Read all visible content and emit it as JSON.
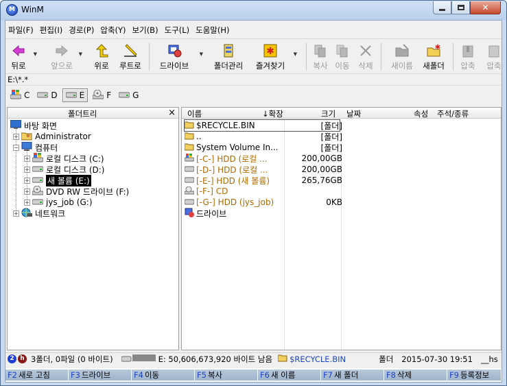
{
  "window": {
    "title": "WinM"
  },
  "menu": [
    "파일(F)",
    "편집(I)",
    "경로(P)",
    "압축(Y)",
    "보기(B)",
    "도구(L)",
    "도움말(H)"
  ],
  "toolbar": {
    "back": "뒤로",
    "forward": "앞으로",
    "up": "위로",
    "root": "루트로",
    "drive": "드라이브",
    "folder_manage": "폴더관리",
    "favorites": "즐겨찾기",
    "copy": "복사",
    "move": "이동",
    "delete": "삭제",
    "rename": "새이름",
    "new_folder": "새폴더",
    "compress": "압축",
    "compress2": "압축"
  },
  "path": "E:\\*.*",
  "drives": [
    "C",
    "D",
    "E",
    "F",
    "G"
  ],
  "selected_drive": "E",
  "tree": {
    "header": "폴더트리",
    "close": "×",
    "items": [
      {
        "label": "바탕 화면"
      },
      {
        "label": "Administrator"
      },
      {
        "label": "컴퓨터"
      },
      {
        "label": "로컬 디스크 (C:)"
      },
      {
        "label": "로컬 디스크 (D:)"
      },
      {
        "label": "새 볼륨 (E:)"
      },
      {
        "label": "DVD RW 드라이브 (F:)"
      },
      {
        "label": "jys_job (G:)"
      },
      {
        "label": "네트워크"
      }
    ]
  },
  "files": {
    "columns": {
      "name": "이름",
      "ext": "↓확장",
      "size": "크기",
      "date": "날짜",
      "attr": "속성",
      "comment": "주석/종류"
    },
    "rows": [
      {
        "name": "$RECYCLE.BIN",
        "size": "[폴더]"
      },
      {
        "name": "..",
        "size": "[폴더]"
      },
      {
        "name": "System Volume In...",
        "size": "[폴더]"
      },
      {
        "name": "[-C-] HDD (로컬 ...",
        "size": "200,00GB"
      },
      {
        "name": "[-D-] HDD (로컬 ...",
        "size": "200,00GB"
      },
      {
        "name": "[-E-] HDD (새 볼륨)",
        "size": "265,76GB"
      },
      {
        "name": "[-F-] CD",
        "size": ""
      },
      {
        "name": "[-G-] HDD (jys_job)",
        "size": "0KB"
      },
      {
        "name": "드라이브",
        "size": ""
      }
    ]
  },
  "status": {
    "badge1": "2",
    "badge2": "h",
    "summary": "3폴더, 0파일 (0 바이트)",
    "free": "E: 50,606,673,920 바이트 남음",
    "current": "$RECYCLE.BIN",
    "type": "폴더",
    "datetime": "2015-07-30 19:51",
    "attr": "__hs"
  },
  "fkeys": [
    {
      "key": "F2",
      "label": "새로 고침"
    },
    {
      "key": "F3",
      "label": "드라이브"
    },
    {
      "key": "F4",
      "label": "이동"
    },
    {
      "key": "F5",
      "label": "복사"
    },
    {
      "key": "F6",
      "label": "새 이름"
    },
    {
      "key": "F7",
      "label": "새 폴더"
    },
    {
      "key": "F8",
      "label": "삭제"
    },
    {
      "key": "F9",
      "label": "등록정보"
    }
  ],
  "colors": {
    "accent_orange": "#b06a00",
    "fkey_blue": "#1a43c8",
    "titlebar": "#c9daf0"
  }
}
